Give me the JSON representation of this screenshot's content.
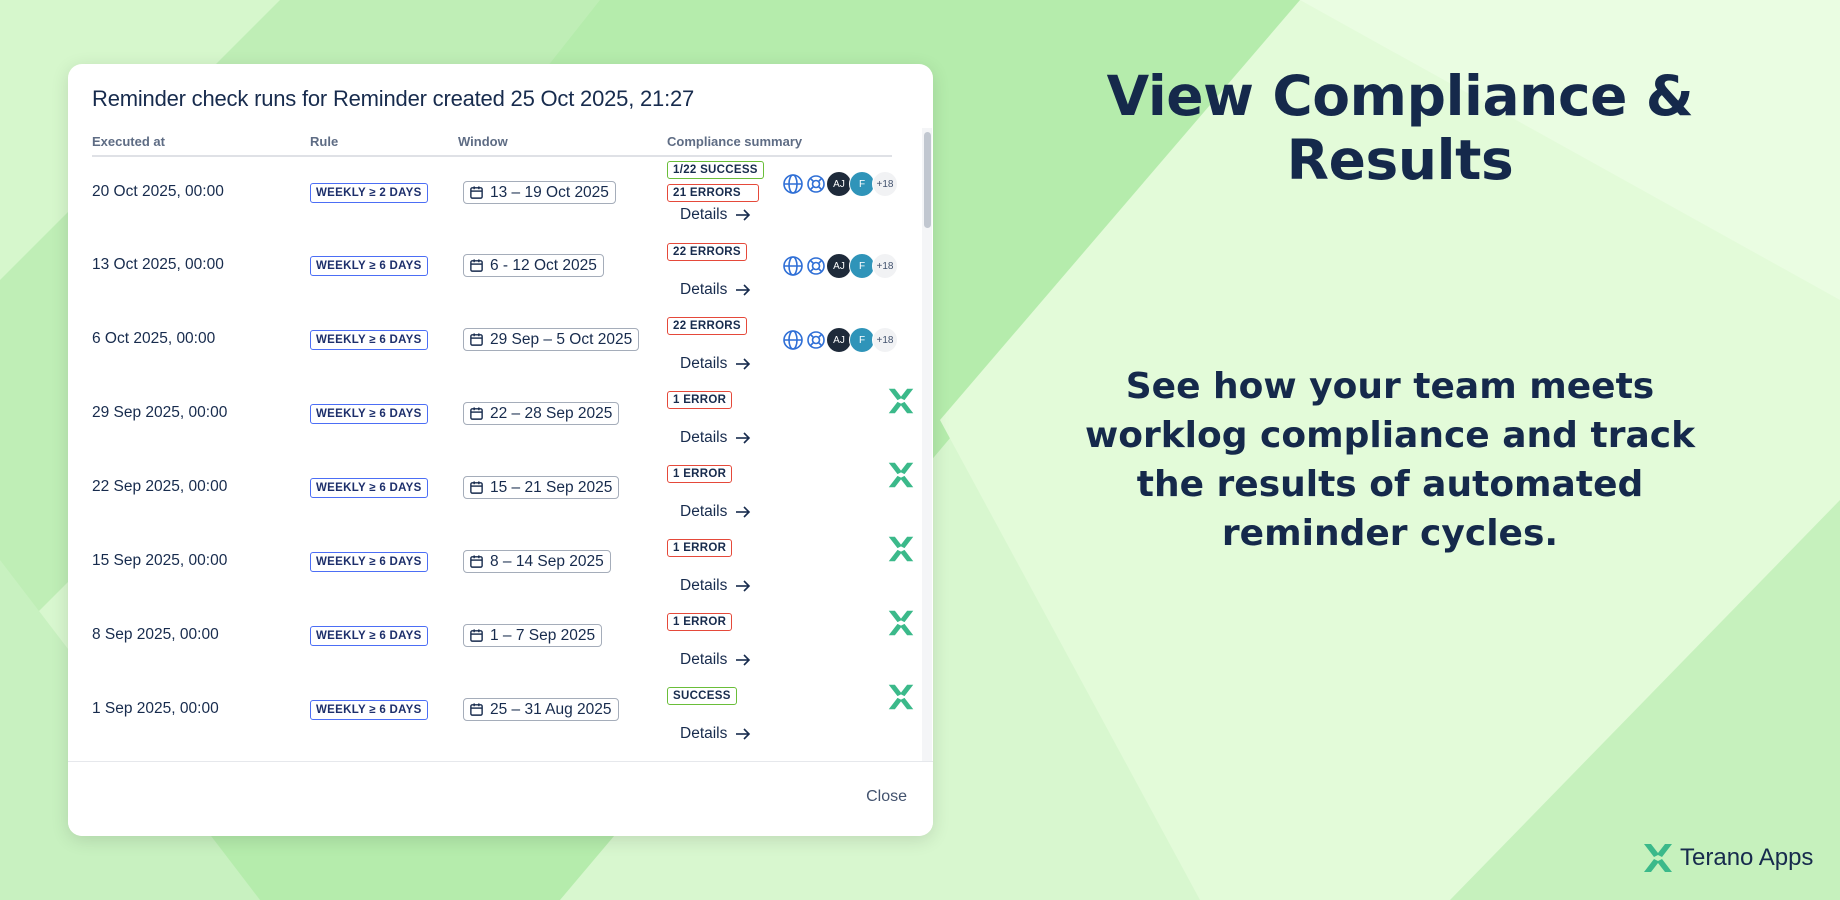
{
  "modal": {
    "title": "Reminder check runs for Reminder created 25 Oct 2025, 21:27",
    "columns": [
      "Executed at",
      "Rule",
      "Window",
      "Compliance summary"
    ],
    "details_label": "Details",
    "close_label": "Close",
    "rows": [
      {
        "executed": "20 Oct 2025, 00:00",
        "rule": "WEEKLY ≥ 2 DAYS",
        "window": "13 – 19 Oct 2025",
        "statuses": [
          {
            "text": "1/22 SUCCESS",
            "kind": "success"
          },
          {
            "text": "21 ERRORS",
            "kind": "error"
          }
        ],
        "avatars": true,
        "more": "+18"
      },
      {
        "executed": "13 Oct 2025, 00:00",
        "rule": "WEEKLY ≥ 6 DAYS",
        "window": "6 - 12 Oct 2025",
        "statuses": [
          {
            "text": "22 ERRORS",
            "kind": "error"
          }
        ],
        "avatars": true,
        "more": "+18"
      },
      {
        "executed": "6 Oct 2025, 00:00",
        "rule": "WEEKLY ≥ 6 DAYS",
        "window": "29 Sep – 5 Oct 2025",
        "statuses": [
          {
            "text": "22 ERRORS",
            "kind": "error"
          }
        ],
        "avatars": true,
        "more": "+18"
      },
      {
        "executed": "29 Sep 2025, 00:00",
        "rule": "WEEKLY ≥ 6 DAYS",
        "window": "22 – 28 Sep 2025",
        "statuses": [
          {
            "text": "1 ERROR",
            "kind": "error"
          }
        ],
        "avatars": false
      },
      {
        "executed": "22 Sep 2025, 00:00",
        "rule": "WEEKLY ≥ 6 DAYS",
        "window": "15 – 21 Sep 2025",
        "statuses": [
          {
            "text": "1 ERROR",
            "kind": "error"
          }
        ],
        "avatars": false
      },
      {
        "executed": "15 Sep 2025, 00:00",
        "rule": "WEEKLY ≥ 6 DAYS",
        "window": "8 – 14 Sep 2025",
        "statuses": [
          {
            "text": "1 ERROR",
            "kind": "error"
          }
        ],
        "avatars": false
      },
      {
        "executed": "8 Sep 2025, 00:00",
        "rule": "WEEKLY ≥ 6 DAYS",
        "window": "1 – 7 Sep 2025",
        "statuses": [
          {
            "text": "1 ERROR",
            "kind": "error"
          }
        ],
        "avatars": false
      },
      {
        "executed": "1 Sep 2025, 00:00",
        "rule": "WEEKLY ≥ 6 DAYS",
        "window": "25 – 31 Aug 2025",
        "statuses": [
          {
            "text": "SUCCESS",
            "kind": "success"
          }
        ],
        "avatars": false
      }
    ],
    "avatar_initials": [
      "AJ",
      "F"
    ]
  },
  "headline": "View Compliance & Results",
  "subtext": "See how your team meets worklog compliance and track the results of automated reminder cycles.",
  "brand": {
    "name": "Terano Apps",
    "icon": "terano-x-logo"
  },
  "colors": {
    "navy": "#15294b",
    "error": "#e5493a",
    "success": "#6abe39",
    "rule_border": "#4c6ef5",
    "logo_green": "#3bb98a"
  }
}
